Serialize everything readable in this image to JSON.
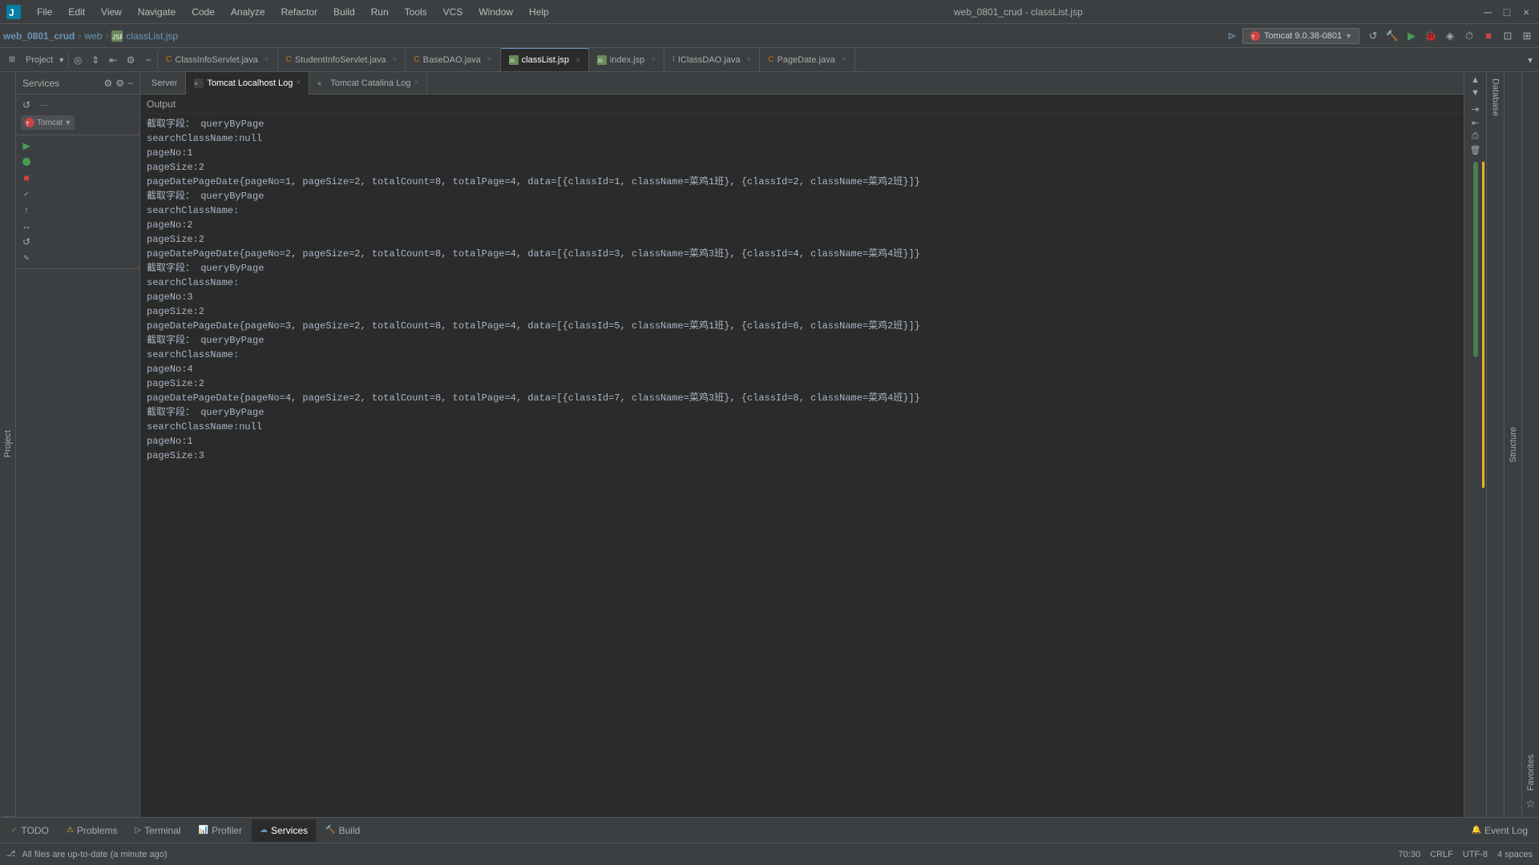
{
  "titleBar": {
    "logo": "intellij-logo",
    "menus": [
      "File",
      "Edit",
      "View",
      "Navigate",
      "Code",
      "Analyze",
      "Refactor",
      "Build",
      "Run",
      "Tools",
      "VCS",
      "Window",
      "Help"
    ],
    "title": "web_0801_crud - classList.jsp",
    "winBtns": [
      "─",
      "□",
      "×"
    ]
  },
  "breadcrumb": {
    "project": "web_0801_crud",
    "separator1": ">",
    "web": "web",
    "separator2": ">",
    "file": "classList.jsp"
  },
  "editorTabs": [
    {
      "name": "ClassInfoServlet.java",
      "type": "java",
      "active": false,
      "closable": true
    },
    {
      "name": "StudentInfoServlet.java",
      "type": "java",
      "active": false,
      "closable": true
    },
    {
      "name": "BaseDAO.java",
      "type": "java",
      "active": false,
      "closable": true
    },
    {
      "name": "classList.jsp",
      "type": "jsp",
      "active": true,
      "closable": true
    },
    {
      "name": "index.jsp",
      "type": "jsp",
      "active": false,
      "closable": true
    },
    {
      "name": "IClassDAO.java",
      "type": "interface",
      "active": false,
      "closable": true
    },
    {
      "name": "PageDate.java",
      "type": "java",
      "active": false,
      "closable": true
    }
  ],
  "navToolbar": {
    "tomcat": "Tomcat 9.0.38-0801",
    "refreshBtn": "↺",
    "buildBtn": "🔨"
  },
  "servicesPanel": {
    "title": "Services",
    "serverName": "Tomcat",
    "serverItems": [
      {
        "label": "Server",
        "active": false
      },
      {
        "label": "Tomcat Localhost Log",
        "active": true
      },
      {
        "label": "Tomcat Catalina Log",
        "active": false
      }
    ]
  },
  "outputHeader": "Output",
  "outputLines": [
    "截取字段： queryByPage",
    "searchClassName:null",
    "pageNo:1",
    "pageSize:2",
    "pageDatePageDate{pageNo=1, pageSize=2, totalCount=8, totalPage=4, data=[{classId=1, className=菜鸡1班}, {classId=2, className=菜鸡2班}]}",
    "截取字段： queryByPage",
    "searchClassName:",
    "pageNo:2",
    "pageSize:2",
    "pageDatePageDate{pageNo=2, pageSize=2, totalCount=8, totalPage=4, data=[{classId=3, className=菜鸡3班}, {classId=4, className=菜鸡4班}]}",
    "截取字段： queryByPage",
    "searchClassName:",
    "pageNo:3",
    "pageSize:2",
    "pageDatePageDate{pageNo=3, pageSize=2, totalCount=8, totalPage=4, data=[{classId=5, className=菜鸡1班}, {classId=6, className=菜鸡2班}]}",
    "截取字段： queryByPage",
    "searchClassName:",
    "pageNo:4",
    "pageSize:2",
    "pageDatePageDate{pageNo=4, pageSize=2, totalCount=8, totalPage=4, data=[{classId=7, className=菜鸡3班}, {classId=8, className=菜鸡4班}]}",
    "截取字段： queryByPage",
    "searchClassName:null",
    "pageNo:1",
    "pageSize:3"
  ],
  "bottomTabs": [
    {
      "label": "TODO",
      "icon": "✓",
      "active": false
    },
    {
      "label": "Problems",
      "icon": "⚠",
      "active": false
    },
    {
      "label": "Terminal",
      "icon": ">_",
      "active": false
    },
    {
      "label": "Profiler",
      "icon": "📊",
      "active": false
    },
    {
      "label": "Services",
      "icon": "☁",
      "active": true
    },
    {
      "label": "Build",
      "icon": "🔨",
      "active": false
    }
  ],
  "statusBar": {
    "leftMsg": "All files are up-to-date (a minute ago)",
    "position": "70:30",
    "lineEnding": "CRLF",
    "encoding": "UTF-8",
    "indentation": "4 spaces"
  }
}
